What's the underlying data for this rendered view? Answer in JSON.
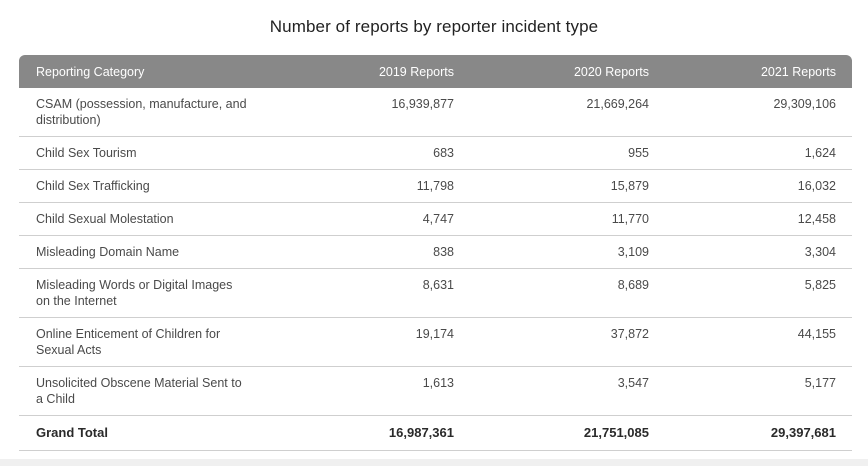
{
  "title": "Number of reports by reporter incident type",
  "header": {
    "category": "Reporting Category",
    "y2019": "2019 Reports",
    "y2020": "2020 Reports",
    "y2021": "2021 Reports"
  },
  "rows": [
    {
      "category": "CSAM (possession, manufacture, and distribution)",
      "y2019": "16,939,877",
      "y2020": "21,669,264",
      "y2021": "29,309,106"
    },
    {
      "category": "Child Sex Tourism",
      "y2019": "683",
      "y2020": "955",
      "y2021": "1,624"
    },
    {
      "category": "Child Sex Trafficking",
      "y2019": "11,798",
      "y2020": "15,879",
      "y2021": "16,032"
    },
    {
      "category": "Child Sexual Molestation",
      "y2019": "4,747",
      "y2020": "11,770",
      "y2021": "12,458"
    },
    {
      "category": "Misleading Domain Name",
      "y2019": "838",
      "y2020": "3,109",
      "y2021": "3,304"
    },
    {
      "category": "Misleading Words or Digital Images on the Internet",
      "y2019": "8,631",
      "y2020": "8,689",
      "y2021": "5,825"
    },
    {
      "category": "Online Enticement of Children for Sexual Acts",
      "y2019": "19,174",
      "y2020": "37,872",
      "y2021": "44,155"
    },
    {
      "category": "Unsolicited Obscene Material Sent to a Child",
      "y2019": "1,613",
      "y2020": "3,547",
      "y2021": "5,177"
    }
  ],
  "total": {
    "category": "Grand Total",
    "y2019": "16,987,361",
    "y2020": "21,751,085",
    "y2021": "29,397,681"
  }
}
